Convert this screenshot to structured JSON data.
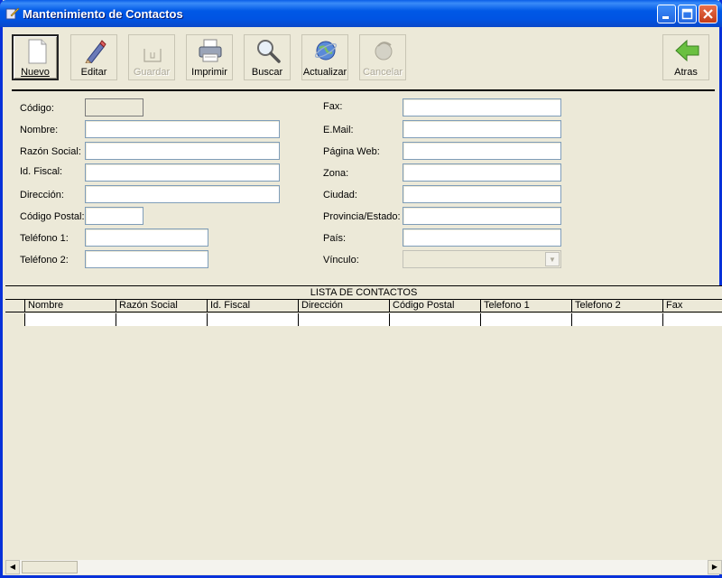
{
  "window": {
    "title": "Mantenimiento de Contactos",
    "minimize_label": "_",
    "maximize_label": "□",
    "close_label": "✕"
  },
  "toolbar": {
    "nuevo": "Nuevo",
    "editar": "Editar",
    "guardar": "Guardar",
    "imprimir": "Imprimir",
    "buscar": "Buscar",
    "actualizar": "Actualizar",
    "cancelar": "Cancelar",
    "atras": "Atras"
  },
  "form": {
    "codigo": {
      "label": "Código:",
      "value": ""
    },
    "nombre": {
      "label": "Nombre:",
      "value": ""
    },
    "razon_social": {
      "label": "Razón Social:",
      "value": ""
    },
    "id_fiscal": {
      "label": "Id. Fiscal:",
      "value": ""
    },
    "direccion": {
      "label": "Dirección:",
      "value": ""
    },
    "codigo_postal": {
      "label": "Código Postal:",
      "value": ""
    },
    "telefono1": {
      "label": "Teléfono 1:",
      "value": ""
    },
    "telefono2": {
      "label": "Teléfono 2:",
      "value": ""
    },
    "fax": {
      "label": "Fax:",
      "value": ""
    },
    "email": {
      "label": "E.Mail:",
      "value": ""
    },
    "web": {
      "label": "Página Web:",
      "value": ""
    },
    "zona": {
      "label": "Zona:",
      "value": ""
    },
    "ciudad": {
      "label": "Ciudad:",
      "value": ""
    },
    "provincia": {
      "label": "Provincia/Estado:",
      "value": ""
    },
    "pais": {
      "label": "País:",
      "value": ""
    },
    "vinculo": {
      "label": "Vínculo:",
      "value": ""
    }
  },
  "grid": {
    "caption": "LISTA DE CONTACTOS",
    "columns": [
      "Nombre",
      "Razón Social",
      "Id. Fiscal",
      "Dirección",
      "Código Postal",
      "Telefono 1",
      "Telefono 2",
      "Fax"
    ]
  },
  "colors": {
    "title_bar": "#0054e3",
    "window_bg": "#ece9d8",
    "field_border": "#7f9db9"
  }
}
